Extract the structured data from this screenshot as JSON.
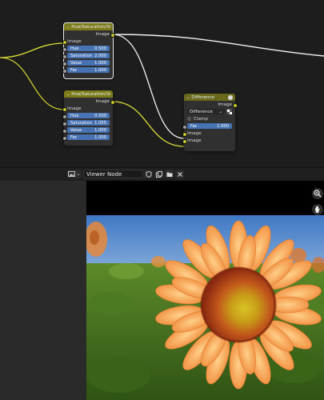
{
  "colors": {
    "node_bg": "#303030",
    "color_socket": "#c7c729",
    "float_socket": "#a1a1a1",
    "field_blue": "#4772b3",
    "header_color": "#7b7b1c"
  },
  "nodes": {
    "hsv1": {
      "title": "Hue/Saturation/Value",
      "output_label": "Image",
      "input_label": "Image",
      "fields": [
        {
          "label": "Hue",
          "value": "0.500"
        },
        {
          "label": "Saturation",
          "value": "2.000"
        },
        {
          "label": "Value",
          "value": "1.000"
        },
        {
          "label": "Fac",
          "value": "1.000"
        }
      ]
    },
    "hsv2": {
      "title": "Hue/Saturation/Value",
      "output_label": "Image",
      "input_label": "Image",
      "fields": [
        {
          "label": "Hue",
          "value": "0.500"
        },
        {
          "label": "Saturation",
          "value": "1.055"
        },
        {
          "label": "Value",
          "value": "1.000"
        },
        {
          "label": "Fac",
          "value": "1.000"
        }
      ]
    },
    "diff": {
      "title": "Difference",
      "output_label": "Image",
      "blend_mode": "Difference",
      "clamp_label": "Clamp",
      "fac_label": "Fac",
      "fac_value": "1.000",
      "input1_label": "Image",
      "input2_label": "Image"
    }
  },
  "image_editor": {
    "image_name": "Viewer Node",
    "editor_type_icon": "image-editor-icon",
    "header_icons": [
      "fake-user-shield-icon",
      "duplicate-icon",
      "open-folder-icon",
      "close-icon"
    ],
    "tool_icons": [
      "zoom-icon",
      "hand-pan-icon"
    ]
  }
}
